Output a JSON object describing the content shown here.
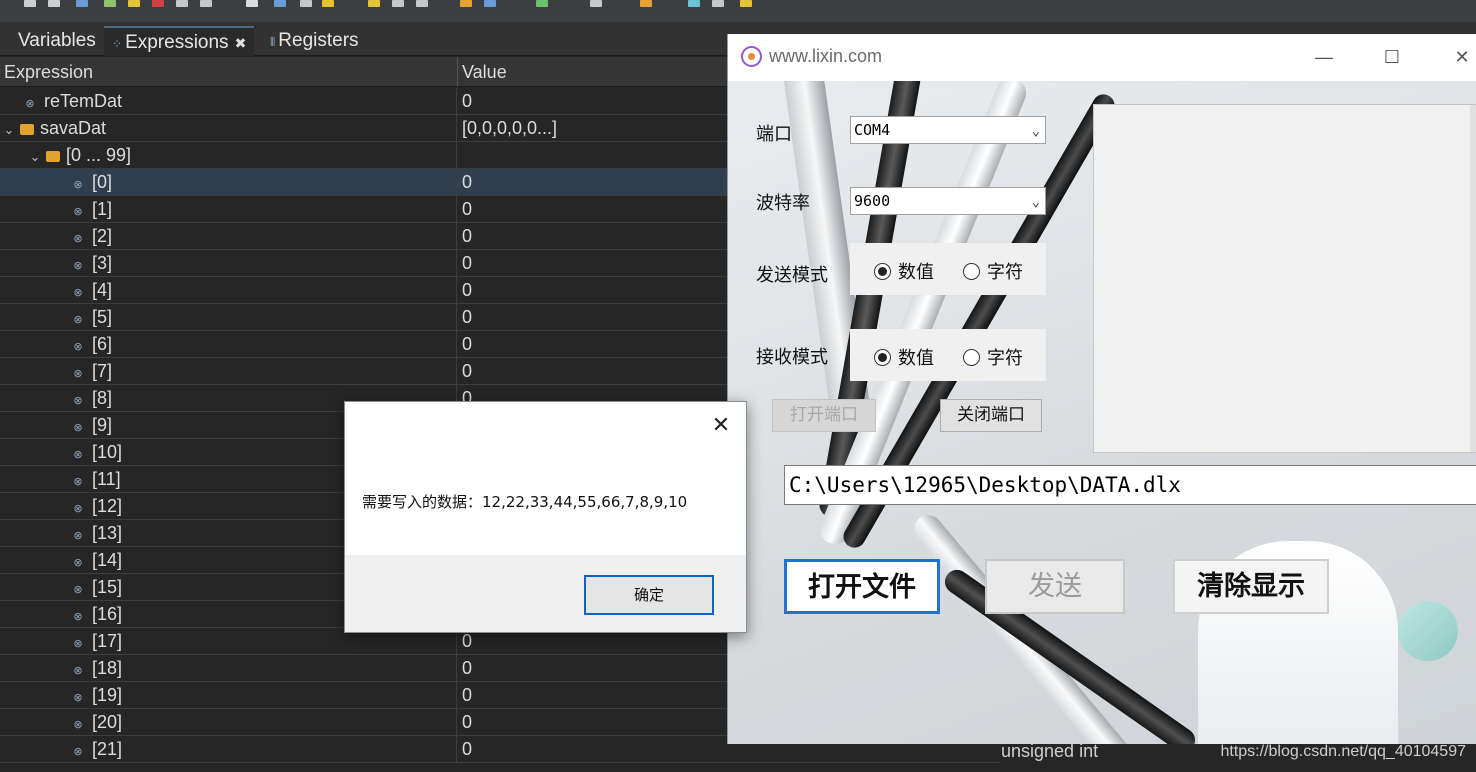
{
  "ide": {
    "tabs": [
      {
        "label": "Variables",
        "active": false
      },
      {
        "label": "Expressions",
        "active": true
      },
      {
        "label": "Registers",
        "active": false
      }
    ],
    "columns": {
      "expression": "Expression",
      "value": "Value"
    },
    "rows": [
      {
        "name": "reTemDat",
        "value": "0"
      },
      {
        "name": "savaDat",
        "value": "[0,0,0,0,0...]"
      },
      {
        "name": "[0 ... 99]",
        "value": ""
      },
      {
        "name": "[0]",
        "value": "0"
      },
      {
        "name": "[1]",
        "value": "0"
      },
      {
        "name": "[2]",
        "value": "0"
      },
      {
        "name": "[3]",
        "value": "0"
      },
      {
        "name": "[4]",
        "value": "0"
      },
      {
        "name": "[5]",
        "value": "0"
      },
      {
        "name": "[6]",
        "value": "0"
      },
      {
        "name": "[7]",
        "value": "0"
      },
      {
        "name": "[8]",
        "value": "0"
      },
      {
        "name": "[9]",
        "value": ""
      },
      {
        "name": "[10]",
        "value": ""
      },
      {
        "name": "[11]",
        "value": ""
      },
      {
        "name": "[12]",
        "value": ""
      },
      {
        "name": "[13]",
        "value": ""
      },
      {
        "name": "[14]",
        "value": ""
      },
      {
        "name": "[15]",
        "value": ""
      },
      {
        "name": "[16]",
        "value": ""
      },
      {
        "name": "[17]",
        "value": "0"
      },
      {
        "name": "[18]",
        "value": "0"
      },
      {
        "name": "[19]",
        "value": "0"
      },
      {
        "name": "[20]",
        "value": "0"
      },
      {
        "name": "[21]",
        "value": "0"
      }
    ],
    "bottom_type": "unsigned int",
    "watermark": "https://blog.csdn.net/qq_40104597"
  },
  "app": {
    "title": "www.lixin.com",
    "port_label": "端口",
    "port_value": "COM4",
    "baud_label": "波特率",
    "baud_value": "9600",
    "send_mode_label": "发送模式",
    "recv_mode_label": "接收模式",
    "radio_numeric": "数值",
    "radio_char": "字符",
    "open_port": "打开端口",
    "close_port": "关闭端口",
    "file_path": "C:\\Users\\12965\\Desktop\\DATA.dlx",
    "open_file": "打开文件",
    "send": "发送",
    "clear": "清除显示"
  },
  "dialog": {
    "message": "需要写入的数据：12,22,33,44,55,66,7,8,9,10",
    "ok": "确定"
  }
}
